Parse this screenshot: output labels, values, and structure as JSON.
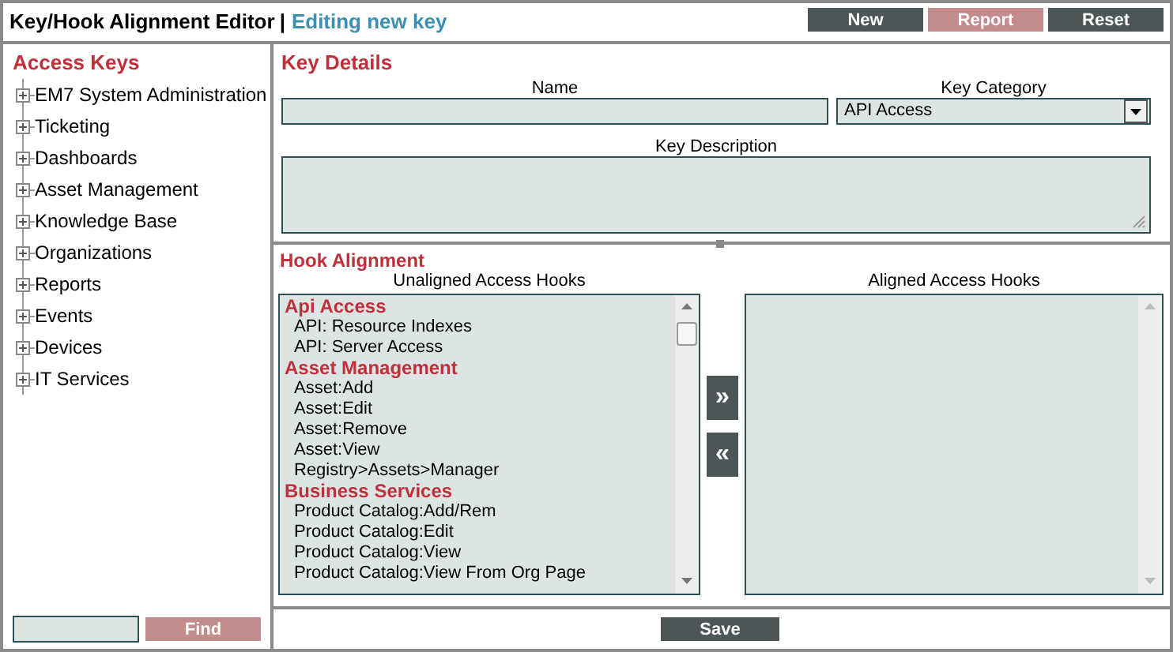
{
  "header": {
    "title": "Key/Hook Alignment Editor",
    "separator": "|",
    "subtitle": "Editing new key"
  },
  "header_buttons": [
    {
      "label": "New",
      "disabled": false
    },
    {
      "label": "Report",
      "disabled": true
    },
    {
      "label": "Reset",
      "disabled": false
    }
  ],
  "access_keys": {
    "title": "Access Keys",
    "items": [
      {
        "label": "EM7 System Administration",
        "expanded": false
      },
      {
        "label": "Ticketing",
        "expanded": false
      },
      {
        "label": "Dashboards",
        "expanded": false
      },
      {
        "label": "Asset Management",
        "expanded": false
      },
      {
        "label": "Knowledge Base",
        "expanded": false
      },
      {
        "label": "Organizations",
        "expanded": false
      },
      {
        "label": "Reports",
        "expanded": false
      },
      {
        "label": "Events",
        "expanded": false
      },
      {
        "label": "Devices",
        "expanded": false
      },
      {
        "label": "IT Services",
        "expanded": false
      }
    ],
    "find_button": {
      "label": "Find",
      "disabled": true
    }
  },
  "key_details": {
    "title": "Key Details",
    "name_label": "Name",
    "category_label": "Key Category",
    "category_value": "API Access",
    "description_label": "Key Description"
  },
  "hook_alignment": {
    "title": "Hook Alignment",
    "unaligned_label": "Unaligned Access Hooks",
    "aligned_label": "Aligned Access Hooks",
    "add_button": "»",
    "remove_button": "«",
    "unaligned": [
      {
        "kind": "group",
        "label": "Api Access"
      },
      {
        "kind": "item",
        "label": "API: Resource Indexes"
      },
      {
        "kind": "item",
        "label": "API: Server Access"
      },
      {
        "kind": "group",
        "label": "Asset Management"
      },
      {
        "kind": "item",
        "label": "Asset:Add"
      },
      {
        "kind": "item",
        "label": "Asset:Edit"
      },
      {
        "kind": "item",
        "label": "Asset:Remove"
      },
      {
        "kind": "item",
        "label": "Asset:View"
      },
      {
        "kind": "item",
        "label": "Registry>Assets>Manager"
      },
      {
        "kind": "group",
        "label": "Business Services"
      },
      {
        "kind": "item",
        "label": "Product Catalog:Add/Rem"
      },
      {
        "kind": "item",
        "label": "Product Catalog:Edit"
      },
      {
        "kind": "item",
        "label": "Product Catalog:View"
      },
      {
        "kind": "item",
        "label": "Product Catalog:View From Org Page"
      }
    ]
  },
  "save_button": "Save"
}
